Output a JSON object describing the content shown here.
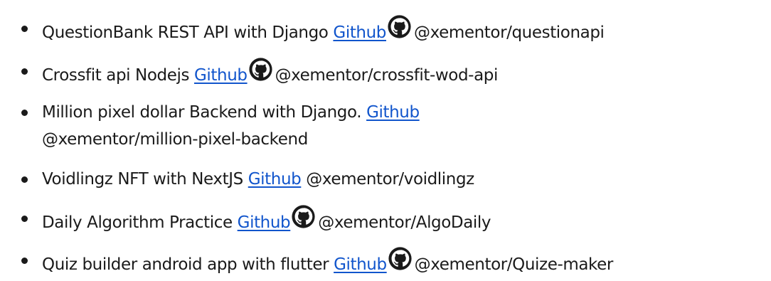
{
  "items": [
    {
      "title": "QuestionBank REST API with Django",
      "link": "Github",
      "icon": "github-icon",
      "handle": "@xementor/questionapi"
    },
    {
      "title": "Crossfit api Nodejs",
      "link": "Github",
      "icon": "github-icon",
      "handle": "@xementor/crossfit-wod-api"
    },
    {
      "title": "Million pixel dollar Backend with Django.",
      "link": "Github",
      "handle": "@xementor/million-pixel-backend"
    },
    {
      "title": "Voidlingz NFT with NextJS",
      "link": "Github",
      "handle": "@xementor/voidlingz"
    },
    {
      "title": "Daily Algorithm Practice",
      "link": "Github",
      "icon": "github-icon",
      "handle": "@xementor/AlgoDaily"
    },
    {
      "title": "Quiz builder android app with flutter",
      "link": "Github",
      "icon": "github-icon",
      "handle": "@xementor/Quize-maker"
    }
  ],
  "colors": {
    "link": "#1155cc",
    "text": "#1a1a1a"
  }
}
